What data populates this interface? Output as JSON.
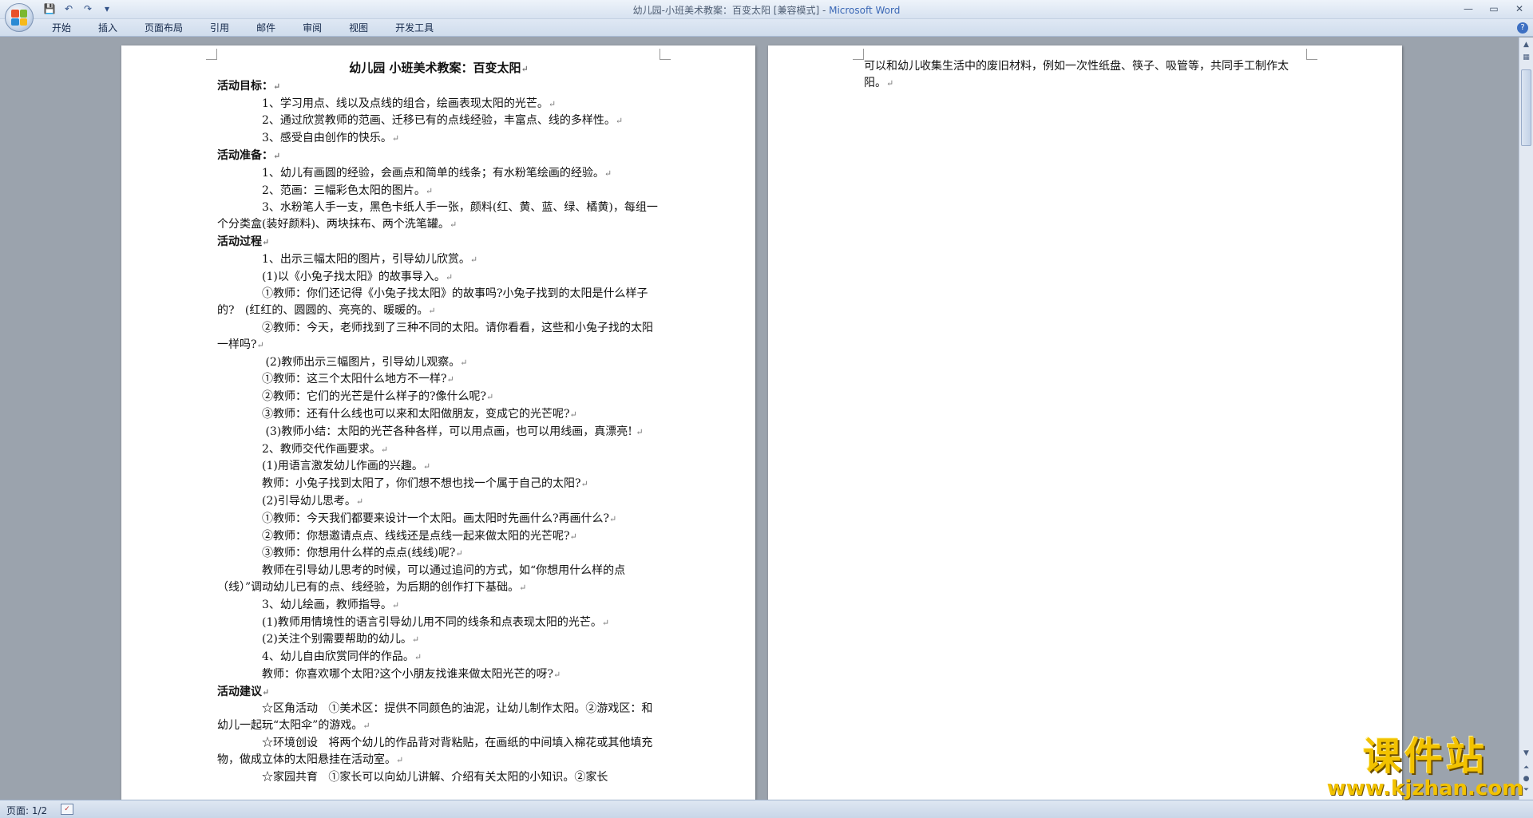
{
  "window": {
    "title_doc": "幼儿园-小班美术教案：百变太阳 [兼容模式] - ",
    "title_app": "Microsoft Word"
  },
  "qat": {
    "save": "💾",
    "undo": "↶",
    "redo": "↷",
    "customize": "▾"
  },
  "controls": {
    "minimize": "—",
    "restore": "▭",
    "close": "✕"
  },
  "ribbon": {
    "tabs": [
      "开始",
      "插入",
      "页面布局",
      "引用",
      "邮件",
      "审阅",
      "视图",
      "开发工具"
    ],
    "help": "?"
  },
  "page1": {
    "title": "幼儿园 小班美术教案：百变太阳",
    "lines": [
      {
        "t": "活动目标：",
        "h": true
      },
      {
        "t": "1、学习用点、线以及点线的组合，绘画表现太阳的光芒。",
        "i": true
      },
      {
        "t": "2、通过欣赏教师的范画、迁移已有的点线经验，丰富点、线的多样性。",
        "i": true
      },
      {
        "t": "3、感受自由创作的快乐。",
        "i": true
      },
      {
        "t": "活动准备：",
        "h": true
      },
      {
        "t": "1、幼儿有画圆的经验，会画点和简单的线条；有水粉笔绘画的经验。",
        "i": true
      },
      {
        "t": "2、范画：三幅彩色太阳的图片。",
        "i": true
      },
      {
        "t": "3、水粉笔人手一支，黑色卡纸人手一张，颜料(红、黄、蓝、绿、橘黄)，每组一个分类盒(装好颜料)、两块抹布、两个洗笔罐。",
        "i": true
      },
      {
        "t": "活动过程",
        "h": true
      },
      {
        "t": "1、出示三幅太阳的图片，引导幼儿欣赏。",
        "i": true
      },
      {
        "t": "(1)以《小兔子找太阳》的故事导入。",
        "i": true
      },
      {
        "t": "①教师：你们还记得《小兔子找太阳》的故事吗?小兔子找到的太阳是什么样子的?   (红红的、圆圆的、亮亮的、暖暖的。",
        "i": true
      },
      {
        "t": "②教师：今天，老师找到了三种不同的太阳。请你看看，这些和小兔子找的太阳一样吗?",
        "i": true
      },
      {
        "t": " (2)教师出示三幅图片，引导幼儿观察。",
        "i": true
      },
      {
        "t": "①教师：这三个太阳什么地方不一样?",
        "i": true
      },
      {
        "t": "②教师：它们的光芒是什么样子的?像什么呢?",
        "i": true
      },
      {
        "t": "③教师：还有什么线也可以来和太阳做朋友，变成它的光芒呢?",
        "i": true
      },
      {
        "t": " (3)教师小结：太阳的光芒各种各样，可以用点画，也可以用线画，真漂亮! ",
        "i": true
      },
      {
        "t": "2、教师交代作画要求。",
        "i": true
      },
      {
        "t": "(1)用语言激发幼儿作画的兴趣。",
        "i": true
      },
      {
        "t": "教师：小兔子找到太阳了，你们想不想也找一个属于自己的太阳?",
        "i": true
      },
      {
        "t": "(2)引导幼儿思考。",
        "i": true
      },
      {
        "t": "①教师：今天我们都要来设计一个太阳。画太阳时先画什么?再画什么?",
        "i": true
      },
      {
        "t": "②教师：你想邀请点点、线线还是点线一起来做太阳的光芒呢?",
        "i": true
      },
      {
        "t": "③教师：你想用什么样的点点(线线)呢?",
        "i": true
      },
      {
        "t": "教师在引导幼儿思考的时候，可以通过追问的方式，如“你想用什么样的点（线）”调动幼儿已有的点、线经验，为后期的创作打下基础。",
        "i": true
      },
      {
        "t": "3、幼儿绘画，教师指导。",
        "i": true
      },
      {
        "t": "(1)教师用情境性的语言引导幼儿用不同的线条和点表现太阳的光芒。",
        "i": true
      },
      {
        "t": "(2)关注个别需要帮助的幼儿。",
        "i": true
      },
      {
        "t": "4、幼儿自由欣赏同伴的作品。",
        "i": true
      },
      {
        "t": "教师：你喜欢哪个太阳?这个小朋友找谁来做太阳光芒的呀?",
        "i": true
      },
      {
        "t": "活动建议",
        "h": true
      },
      {
        "t": "☆区角活动   ①美术区：提供不同颜色的油泥，让幼儿制作太阳。②游戏区：和幼儿一起玩“太阳伞”的游戏。",
        "i": true
      },
      {
        "t": "☆环境创设   将两个幼儿的作品背对背粘贴，在画纸的中间填入棉花或其他填充物，做成立体的太阳悬挂在活动室。",
        "i": true
      },
      {
        "t": "☆家园共育   ①家长可以向幼儿讲解、介绍有关太阳的小知识。②家长",
        "i": true,
        "nomark": true
      }
    ]
  },
  "page2": {
    "lines": [
      {
        "t": "可以和幼儿收集生活中的废旧材料，例如一次性纸盘、筷子、吸管等，共同手工制作太阳。"
      }
    ]
  },
  "status": {
    "page": "页面: 1/2"
  },
  "watermark": {
    "cn": "课件站",
    "url": "www.kjzhan.com"
  }
}
